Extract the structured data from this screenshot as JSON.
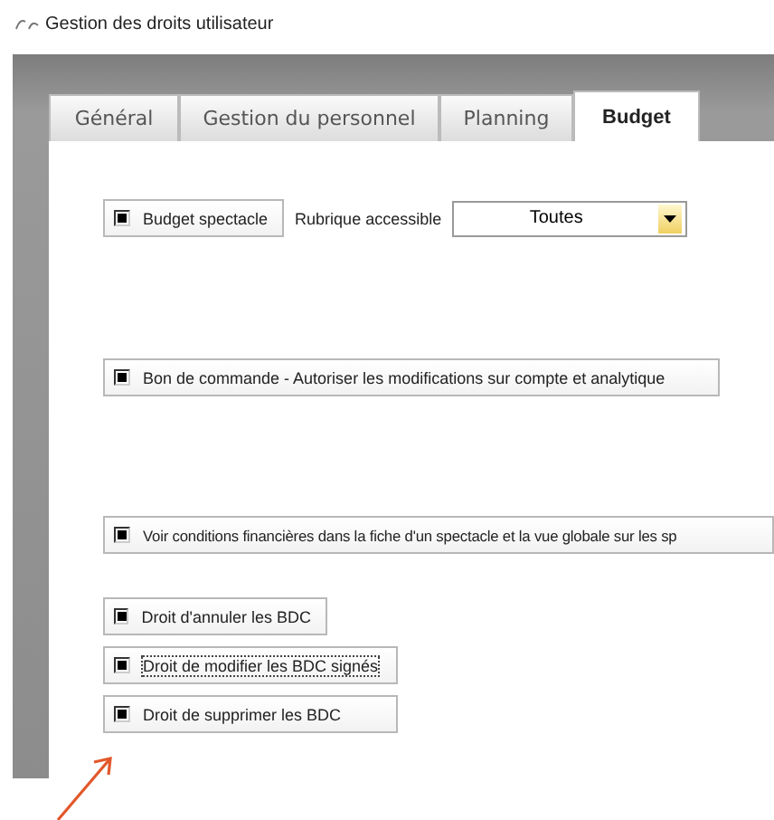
{
  "window": {
    "title": "Gestion des droits utilisateur"
  },
  "tabs": [
    {
      "label": "Général",
      "selected": false
    },
    {
      "label": "Gestion du personnel",
      "selected": false
    },
    {
      "label": "Planning",
      "selected": false
    },
    {
      "label": "Budget",
      "selected": true
    }
  ],
  "budget": {
    "checkbox": {
      "label": "Budget spectacle",
      "checked": true
    },
    "dropdown_label": "Rubrique accessible",
    "dropdown": {
      "value": "Toutes"
    }
  },
  "sections": [
    {
      "options": [
        {
          "label": "Bon de commande - Autoriser les modifications sur compte et analytique",
          "checked": true,
          "focused": false
        }
      ]
    },
    {
      "options": [
        {
          "label": "Voir conditions financières dans la fiche d'un spectacle et la vue globale sur les sp",
          "checked": true,
          "focused": false
        }
      ]
    },
    {
      "options": [
        {
          "label": "Droit d'annuler les BDC",
          "checked": true,
          "focused": false
        },
        {
          "label": "Droit de modifier les BDC signés",
          "checked": true,
          "focused": true
        },
        {
          "label": "Droit de supprimer les BDC",
          "checked": true,
          "focused": false
        }
      ]
    }
  ]
}
